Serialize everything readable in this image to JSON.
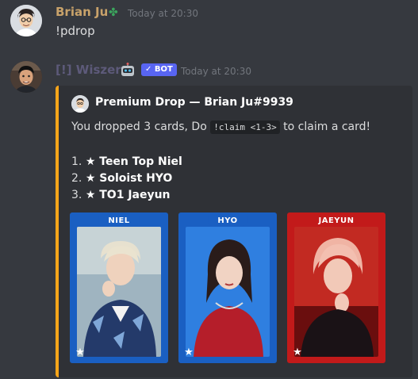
{
  "messages": [
    {
      "author": "Brian Ju",
      "author_color": "#c8a26a",
      "badge_icon": "clover-icon",
      "timestamp": "Today at 20:30",
      "content": "!pdrop"
    },
    {
      "author": "[!] Wiszer",
      "author_color": "#5d5a7a",
      "badge_icon": "robot-icon",
      "bot_tag": "✓ BOT",
      "timestamp": "Today at 20:30",
      "embed": {
        "accent": "#faa61a",
        "author": "Premium Drop — Brian Ju#9939",
        "desc_before": "You dropped 3 cards, Do ",
        "desc_code": "!claim <1-3>",
        "desc_after": " to claim a card!",
        "items": [
          {
            "num": "1.",
            "star": "★",
            "name": "Teen Top Niel"
          },
          {
            "num": "2.",
            "star": "★",
            "name": "Soloist HYO"
          },
          {
            "num": "3.",
            "star": "★",
            "name": "TO1 Jaeyun"
          }
        ],
        "cards": [
          {
            "name": "NIEL",
            "frame_color": "#1a5fc2",
            "star": "★"
          },
          {
            "name": "HYO",
            "frame_color": "#1a5fc2",
            "star": "★"
          },
          {
            "name": "JAEYUN",
            "frame_color": "#c21a1a",
            "star": "★"
          }
        ]
      }
    }
  ]
}
